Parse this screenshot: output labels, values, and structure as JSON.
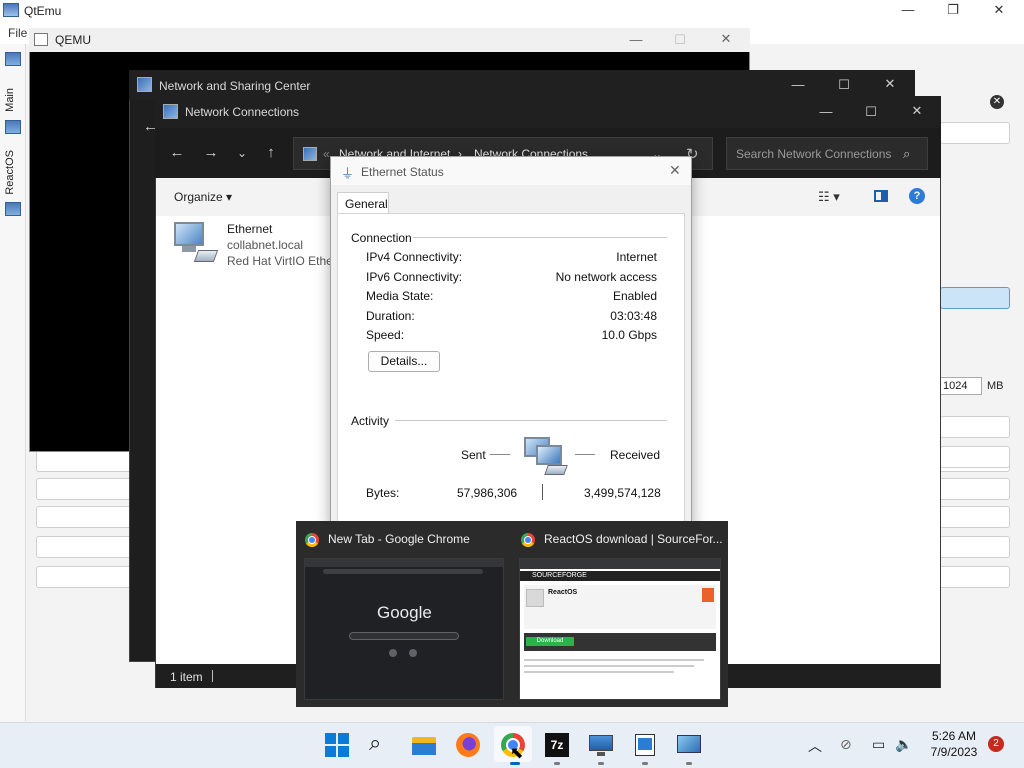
{
  "qtemu": {
    "title": "QtEmu",
    "menu_file": "File",
    "tab_main": "Main",
    "tab_reactos": "ReactOS",
    "ram_value": "1024",
    "ram_unit": "MB",
    "minimize": "—",
    "maximize": "❐",
    "close": "✕"
  },
  "qemu": {
    "title": "QEMU"
  },
  "nsc": {
    "title": "Network and Sharing Center"
  },
  "nc": {
    "title": "Network Connections",
    "address": {
      "prefix": "«",
      "crumb1": "Network and Internet",
      "sep": "›",
      "crumb2": "Network Connections"
    },
    "search_placeholder": "Search Network Connections",
    "organize_label": "Organize",
    "item": {
      "name": "Ethernet",
      "network": "collabnet.local",
      "adapter": "Red Hat VirtIO Ethernet Adapter"
    },
    "status_count": "1 item"
  },
  "ethernet_status": {
    "title": "Ethernet Status",
    "tab": "General",
    "connection_label": "Connection",
    "rows": [
      {
        "label": "IPv4 Connectivity:",
        "value": "Internet"
      },
      {
        "label": "IPv6 Connectivity:",
        "value": "No network access"
      },
      {
        "label": "Media State:",
        "value": "Enabled"
      },
      {
        "label": "Duration:",
        "value": "03:03:48"
      },
      {
        "label": "Speed:",
        "value": "10.0 Gbps"
      }
    ],
    "details_button": "Details...",
    "activity_label": "Activity",
    "sent_label": "Sent",
    "received_label": "Received",
    "bytes_label": "Bytes:",
    "bytes_sent": "57,986,306",
    "bytes_received": "3,499,574,128"
  },
  "thumbnails": [
    {
      "title": "New Tab - Google Chrome",
      "logo": "Google"
    },
    {
      "title": "ReactOS download | SourceFor...",
      "brand": "SOURCEFORGE",
      "project": "ReactOS",
      "download": "Download"
    }
  ],
  "taskbar": {
    "time": "5:26 AM",
    "date": "7/9/2023",
    "notification_count": "2",
    "icons": [
      "windows-start-icon",
      "search-icon",
      "file-explorer-icon",
      "firefox-icon",
      "chrome-icon",
      "7zip-icon",
      "qemu-monitor-icon",
      "notepad-icon",
      "network-icon"
    ]
  },
  "colors": {
    "accent": "#0067c0",
    "dark_chrome": "#202020",
    "notification": "#c42b1c"
  }
}
